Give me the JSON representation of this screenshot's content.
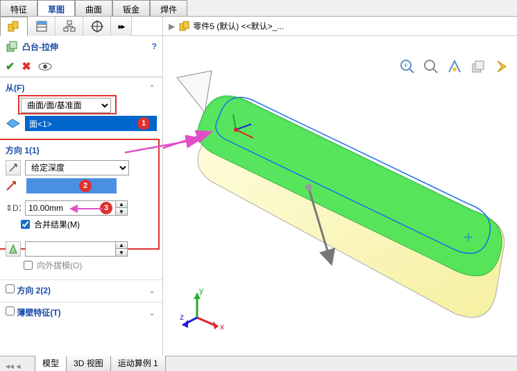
{
  "top_tabs": {
    "features": "特征",
    "sketch": "草图",
    "surface": "曲面",
    "sheetmetal": "钣金",
    "weldment": "焊件"
  },
  "breadcrumb": {
    "part_label": "零件5 (默认) <<默认>_..."
  },
  "feature": {
    "title": "凸台-拉伸"
  },
  "from": {
    "label": "从(F)",
    "combo": "曲面/面/基准面",
    "selected": "面<1>"
  },
  "dir1": {
    "label": "方向 1(1)",
    "combo": "给定深度",
    "depth": "10.00mm",
    "merge_label": "合并结果(M)"
  },
  "draft": {
    "label": "向外拔模(O)"
  },
  "dir2": {
    "label": "方向 2(2)"
  },
  "thin": {
    "label": "薄壁特征(T)"
  },
  "bottom_tabs": {
    "model": "模型",
    "view3d": "3D 视图",
    "motion": "运动算例 1"
  },
  "badges": {
    "b1": "1",
    "b2": "2",
    "b3": "3"
  },
  "triad": {
    "x": "x",
    "y": "y",
    "z": "z"
  }
}
